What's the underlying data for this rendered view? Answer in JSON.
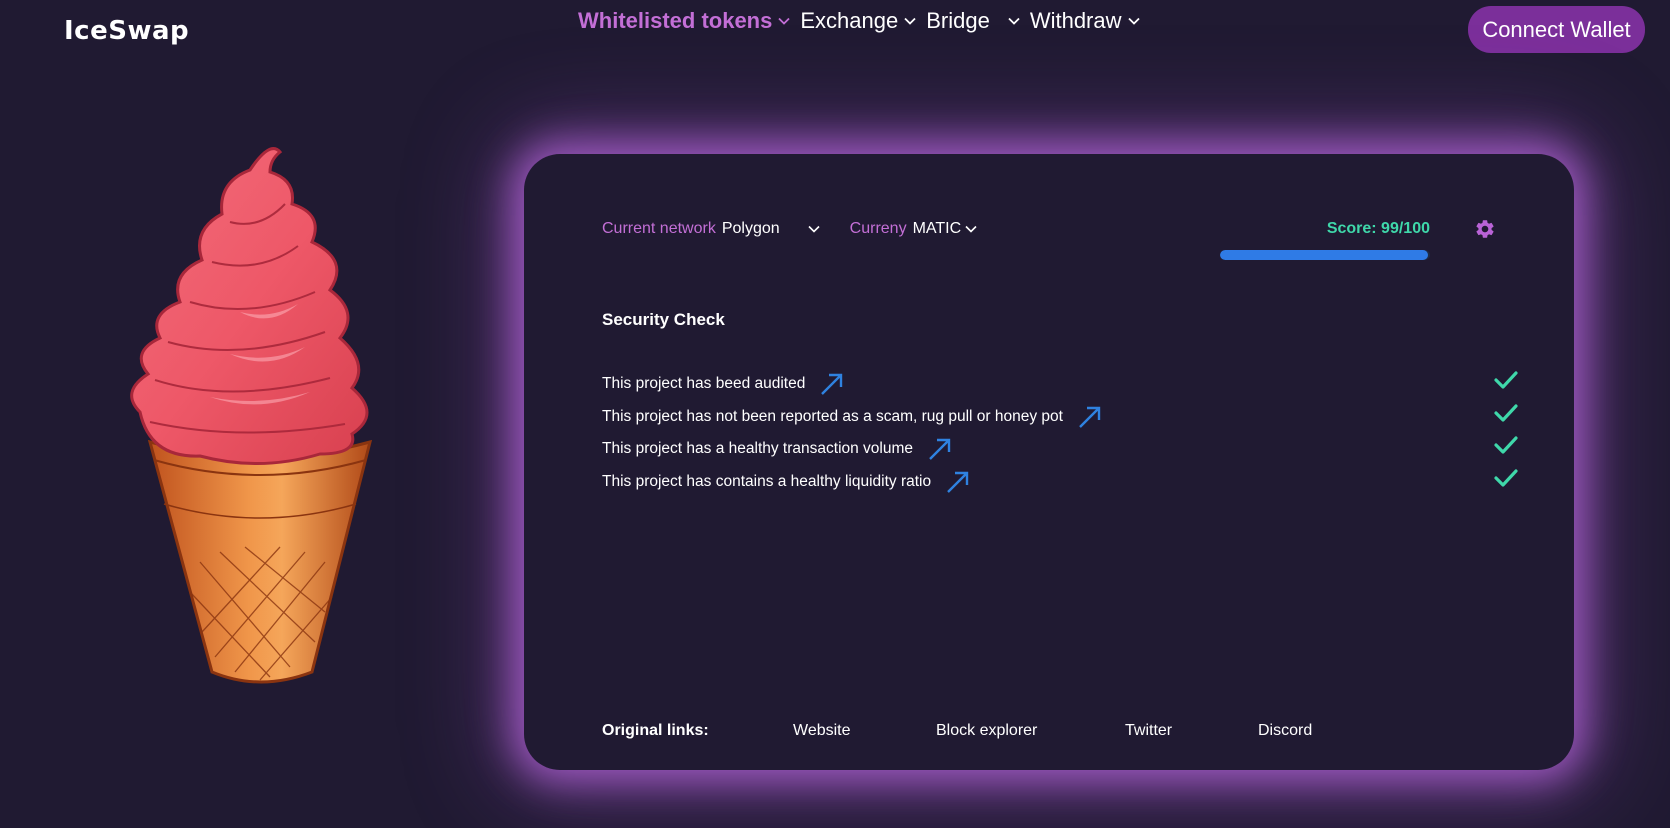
{
  "header": {
    "logo": "IceSwap",
    "nav": [
      {
        "label": "Whitelisted tokens",
        "active": true
      },
      {
        "label": "Exchange"
      },
      {
        "label": "Bridge"
      },
      {
        "label": "Withdraw"
      }
    ],
    "connect_label": "Connect Wallet"
  },
  "card": {
    "network_label": "Current network",
    "network_value": "Polygon",
    "currency_label": "Curreny",
    "currency_value": "MATIC",
    "score_text": "Score: 99/100",
    "score_fraction": 0.99,
    "security_title": "Security Check",
    "checks": [
      {
        "text": "This project has beed audited",
        "passed": true
      },
      {
        "text": "This project has not been reported as a scam, rug pull or honey pot",
        "passed": true
      },
      {
        "text": "This project has a healthy transaction volume",
        "passed": true
      },
      {
        "text": "This project has contains a healthy liquidity ratio",
        "passed": true
      }
    ],
    "links_label": "Original links:",
    "links": [
      "Website",
      "Block explorer",
      "Twitter",
      "Discord"
    ]
  },
  "colors": {
    "background": "#201a32",
    "accent_purple": "#c36fd6",
    "button_purple": "#7b2f9a",
    "score_green": "#3fd8aa",
    "bar_blue": "#2f7be6",
    "arrow_blue": "#2f82e0",
    "glow": "#ae60d2"
  },
  "icons": {
    "nav_dropdown": "chevron-down-icon",
    "settings": "gear-icon",
    "external_link": "arrow-up-right-icon",
    "check": "checkmark-icon",
    "illustration": "ice-cream-cone-image"
  }
}
